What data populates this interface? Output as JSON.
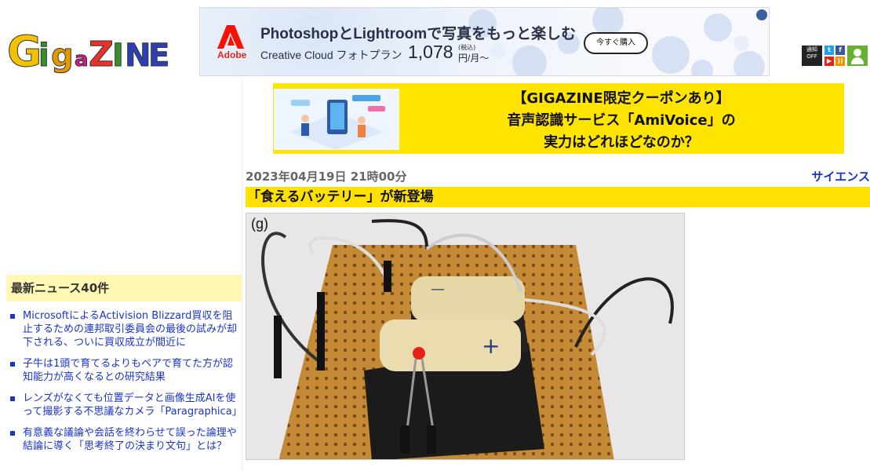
{
  "header": {
    "logo_text": "GIGAZINE",
    "ad": {
      "brand": "Adobe",
      "headline": "PhotoshopとLightroomで写真をもっと楽しむ",
      "subline": "Creative Cloud フォトプラン",
      "price": "1,078",
      "tax_note": "(税込)",
      "price_unit": "円/月～",
      "cta": "今すぐ購入"
    },
    "social": {
      "notify_label": "通知",
      "notify_state": "OFF",
      "icons": [
        "twitter-icon",
        "facebook-icon",
        "youtube-icon",
        "rss-icon",
        "user-icon"
      ]
    }
  },
  "promo": {
    "line1": "【GIGAZINE限定クーポンあり】",
    "line2": "音声認識サービス「AmiVoice」の",
    "line3": "実力はどれほどなのか？"
  },
  "article": {
    "date": "2023年04月19日 21時00分",
    "category": "サイエンス",
    "title": "「食えるバッテリー」が新登場",
    "image_caption": "(g)"
  },
  "sidebar": {
    "title": "最新ニュース40件",
    "items": [
      "MicrosoftによるActivision Blizzard買収を阻止するための連邦取引委員会の最後の試みが却下される、ついに買収成立が間近に",
      "子牛は1頭で育てるよりもペアで育てた方が認知能力が高くなるとの研究結果",
      "レンズがなくても位置データと画像生成AIを使って撮影する不思議なカメラ「Paragraphica」",
      "有意義な議論や会話を終わらせて誤った論理や結論に導く「思考終了の決まり文句」とは？"
    ]
  },
  "colors": {
    "accent_yellow": "#ffe000",
    "sidebar_title_bg": "#fff7b3",
    "link_blue": "#1a33cc",
    "adobe_red": "#fa0f00"
  }
}
